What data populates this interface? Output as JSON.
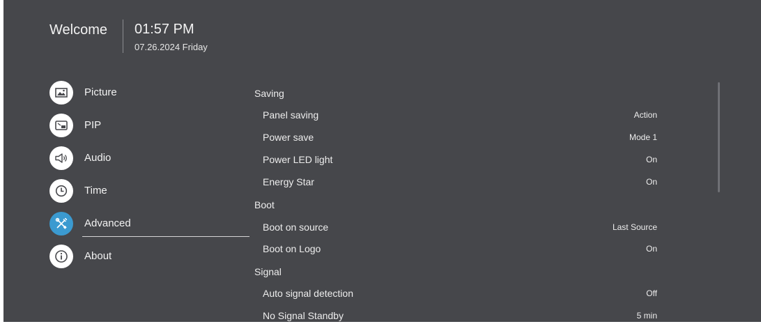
{
  "header": {
    "welcome": "Welcome",
    "time": "01:57 PM",
    "date": "07.26.2024 Friday"
  },
  "menu": {
    "items": [
      {
        "label": "Picture",
        "icon": "picture-icon"
      },
      {
        "label": "PIP",
        "icon": "pip-icon"
      },
      {
        "label": "Audio",
        "icon": "speaker-icon"
      },
      {
        "label": "Time",
        "icon": "clock-icon"
      },
      {
        "label": "Advanced",
        "icon": "tools-icon",
        "selected": true
      },
      {
        "label": "About",
        "icon": "info-icon"
      }
    ]
  },
  "settings": {
    "saving": {
      "title": "Saving",
      "items": [
        {
          "label": "Panel saving",
          "value": "Action"
        },
        {
          "label": "Power save",
          "value": "Mode 1"
        },
        {
          "label": "Power LED light",
          "value": "On"
        },
        {
          "label": "Energy Star",
          "value": "On"
        }
      ]
    },
    "boot": {
      "title": "Boot",
      "items": [
        {
          "label": "Boot on source",
          "value": "Last Source"
        },
        {
          "label": "Boot on Logo",
          "value": "On"
        }
      ]
    },
    "signal": {
      "title": "Signal",
      "items": [
        {
          "label": "Auto signal detection",
          "value": "Off"
        },
        {
          "label": "No Signal Standby",
          "value": "5 min"
        }
      ]
    }
  },
  "colors": {
    "background": "#46474b",
    "accent": "#3b9ad0",
    "text": "#ededed"
  }
}
